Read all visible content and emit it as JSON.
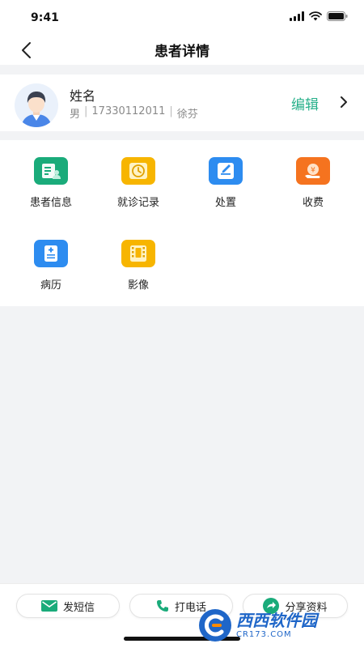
{
  "status": {
    "time": "9:41"
  },
  "nav": {
    "title": "患者详情"
  },
  "patient": {
    "name": "姓名",
    "gender": "男",
    "phone": "17330112011",
    "doctor": "徐芬",
    "edit_label": "编辑"
  },
  "menu": {
    "items": [
      {
        "label": "患者信息",
        "icon": "patient-info-icon",
        "color": "#1aab7a"
      },
      {
        "label": "就诊记录",
        "icon": "clock-icon",
        "color": "#f7b500"
      },
      {
        "label": "处置",
        "icon": "edit-note-icon",
        "color": "#2d8cf0"
      },
      {
        "label": "收费",
        "icon": "payment-icon",
        "color": "#f5731f"
      },
      {
        "label": "病历",
        "icon": "medical-record-icon",
        "color": "#2d8cf0"
      },
      {
        "label": "影像",
        "icon": "film-icon",
        "color": "#f7b500"
      }
    ]
  },
  "actions": {
    "sms_label": "发短信",
    "call_label": "打电话",
    "share_label": "分享资料"
  },
  "watermark": {
    "brand": "西西软件园",
    "domain": "CR173.COM"
  }
}
